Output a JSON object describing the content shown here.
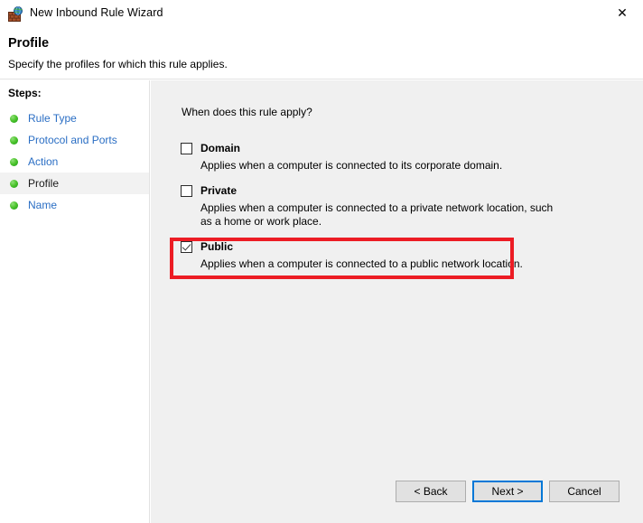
{
  "window": {
    "title": "New Inbound Rule Wizard",
    "icon": "firewall-globe-icon",
    "close_label": "✕"
  },
  "header": {
    "title": "Profile",
    "subtitle": "Specify the profiles for which this rule applies."
  },
  "sidebar": {
    "steps_label": "Steps:",
    "items": [
      {
        "label": "Rule Type",
        "current": false
      },
      {
        "label": "Protocol and Ports",
        "current": false
      },
      {
        "label": "Action",
        "current": false
      },
      {
        "label": "Profile",
        "current": true
      },
      {
        "label": "Name",
        "current": false
      }
    ]
  },
  "main": {
    "question": "When does this rule apply?",
    "profiles": [
      {
        "name": "Domain",
        "description": "Applies when a computer is connected to its corporate domain.",
        "checked": false
      },
      {
        "name": "Private",
        "description": "Applies when a computer is connected to a private network location, such as a home or work place.",
        "checked": false
      },
      {
        "name": "Public",
        "description": "Applies when a computer is connected to a public network location.",
        "checked": true
      }
    ]
  },
  "buttons": {
    "back": "< Back",
    "next": "Next >",
    "cancel": "Cancel"
  },
  "colors": {
    "link": "#2a6ec4",
    "highlight": "#ec1c24",
    "focus": "#0078d7",
    "content_bg": "#f0f0f0"
  }
}
